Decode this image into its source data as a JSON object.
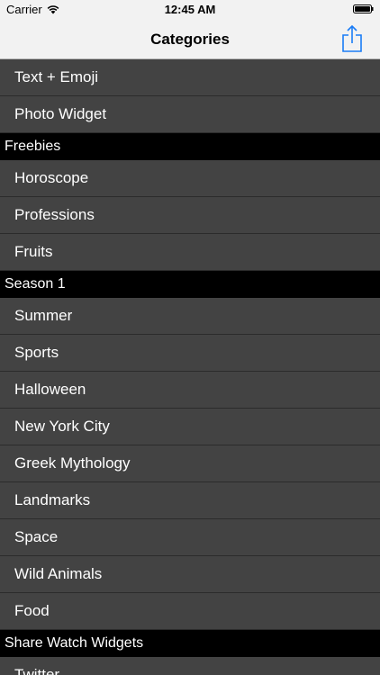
{
  "status_bar": {
    "carrier": "Carrier",
    "time": "12:45 AM"
  },
  "nav": {
    "title": "Categories",
    "share_icon": "share-icon"
  },
  "list": {
    "top_items": [
      "Text + Emoji",
      "Photo Widget"
    ],
    "sections": [
      {
        "header": "Freebies",
        "items": [
          "Horoscope",
          "Professions",
          "Fruits"
        ]
      },
      {
        "header": "Season 1",
        "items": [
          "Summer",
          "Sports",
          "Halloween",
          "New York City",
          "Greek Mythology",
          "Landmarks",
          "Space",
          "Wild Animals",
          "Food"
        ]
      },
      {
        "header": "Share Watch Widgets",
        "items": [
          "Twitter"
        ]
      }
    ]
  },
  "colors": {
    "row_background": "#434343",
    "section_background": "#000000",
    "accent": "#1a7cf6"
  }
}
